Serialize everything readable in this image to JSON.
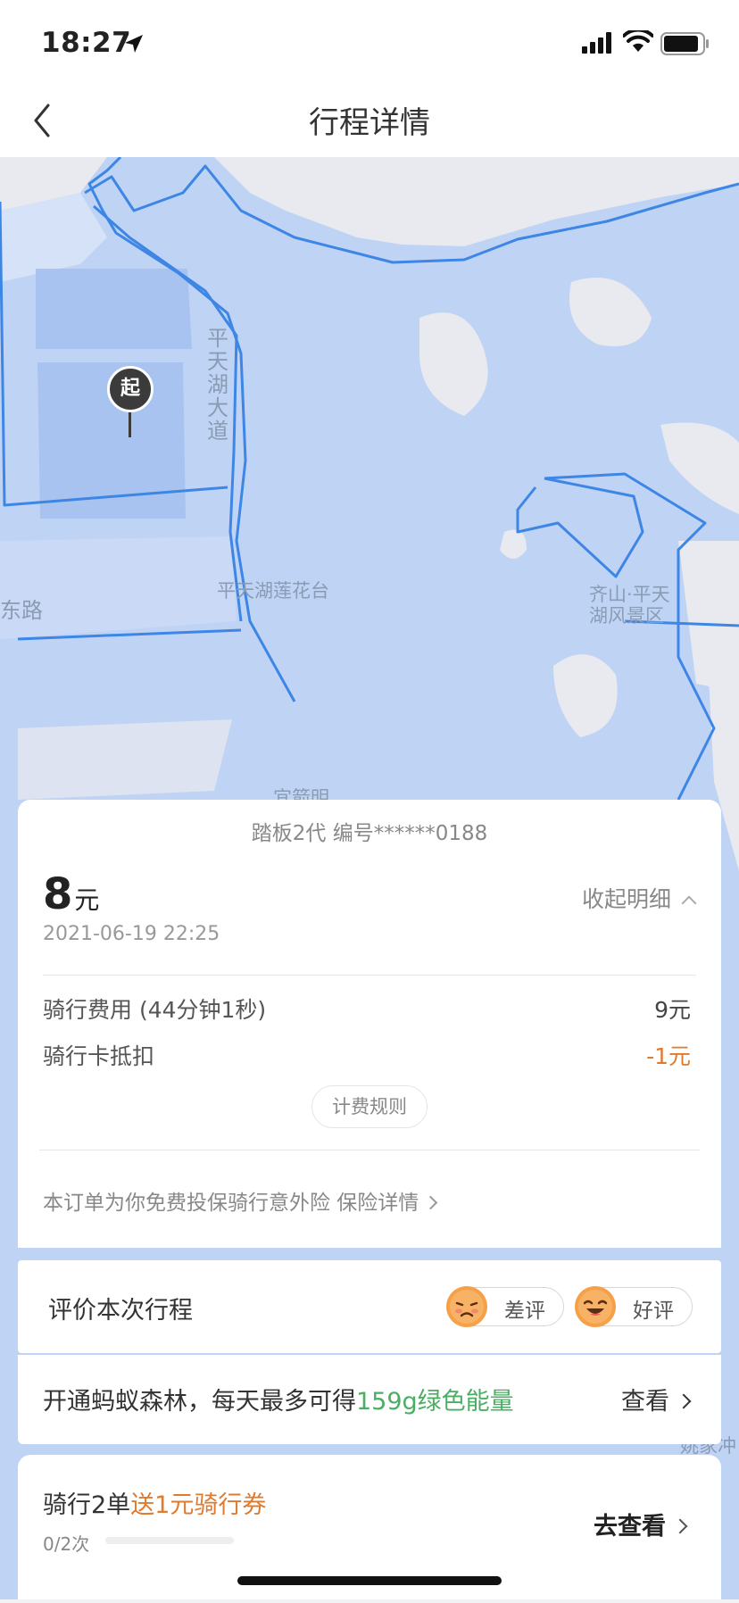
{
  "status_bar": {
    "time": "18:27"
  },
  "nav": {
    "title": "行程详情"
  },
  "map": {
    "start_label": "起",
    "labels": {
      "road": "平天湖大道",
      "lotus": "平天湖莲花台",
      "scenic": "齐山·平天湖风景区",
      "east_road": "东路",
      "building": "宜箭明",
      "village": "姚家冲"
    }
  },
  "order": {
    "bike": "踏板2代 编号******0188",
    "price": "8",
    "price_unit": "元",
    "datetime": "2021-06-19 22:25",
    "collapse_label": "收起明细",
    "fees": [
      {
        "label": "骑行费用 (44分钟1秒)",
        "value": "9元"
      },
      {
        "label": "骑行卡抵扣",
        "value": "-1元"
      }
    ],
    "rules_label": "计费规则",
    "insurance_text": "本订单为你免费投保骑行意外险 保险详情"
  },
  "rating": {
    "title": "评价本次行程",
    "bad": "差评",
    "good": "好评"
  },
  "forest": {
    "text": "开通蚂蚁森林，每天最多可得",
    "highlight": "159g绿色能量",
    "action": "查看"
  },
  "promo": {
    "text": "骑行2单",
    "highlight": "送1元骑行券",
    "progress": "0/2次",
    "progress_fraction": 0,
    "action": "去查看"
  },
  "colors": {
    "accent_orange": "#e07a2e",
    "accent_green": "#4cae64",
    "map_water": "#bfd3f5",
    "map_route": "#3d86e6"
  }
}
